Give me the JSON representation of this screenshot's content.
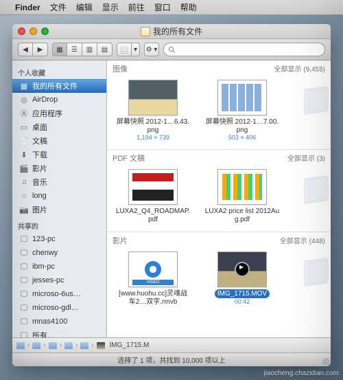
{
  "menubar": {
    "apple": "",
    "app": "Finder",
    "items": [
      "文件",
      "编辑",
      "显示",
      "前往",
      "窗口",
      "帮助"
    ]
  },
  "window": {
    "title": "我的所有文件",
    "search_placeholder": ""
  },
  "sidebar": {
    "section1": "个人收藏",
    "items1": [
      {
        "label": "我的所有文件",
        "icon": "all-files-icon",
        "selected": true
      },
      {
        "label": "AirDrop",
        "icon": "airdrop-icon"
      },
      {
        "label": "应用程序",
        "icon": "applications-icon"
      },
      {
        "label": "桌面",
        "icon": "desktop-icon"
      },
      {
        "label": "文稿",
        "icon": "documents-icon"
      },
      {
        "label": "下载",
        "icon": "downloads-icon"
      },
      {
        "label": "影片",
        "icon": "movies-icon"
      },
      {
        "label": "音乐",
        "icon": "music-icon"
      },
      {
        "label": "long",
        "icon": "home-icon"
      },
      {
        "label": "图片",
        "icon": "pictures-icon"
      }
    ],
    "section2": "共享的",
    "items2": [
      {
        "label": "123-pc"
      },
      {
        "label": "chenwy"
      },
      {
        "label": "ibm-pc"
      },
      {
        "label": "jesses-pc"
      },
      {
        "label": "microso-6us…"
      },
      {
        "label": "microso-gdl…"
      },
      {
        "label": "mnas4100"
      },
      {
        "label": "所有…"
      }
    ]
  },
  "content": {
    "sections": [
      {
        "name": "图像",
        "show_all": "全部显示",
        "count": "(9,455)",
        "items": [
          {
            "name": "屏幕快照 2012-1…6.43.png",
            "meta": "1,194 × 739",
            "thumb": "photo"
          },
          {
            "name": "屏幕快照 2012-1…7.00.png",
            "meta": "503 × 406",
            "thumb": "screen"
          }
        ]
      },
      {
        "name": "PDF 文稿",
        "show_all": "全部显示",
        "count": "(3)",
        "items": [
          {
            "name": "LUXA2_Q4_ROADMAP.pdf",
            "meta": "",
            "thumb": "pdf1"
          },
          {
            "name": "LUXA2 price list 2012Aug.pdf",
            "meta": "",
            "thumb": "pdf2"
          }
        ]
      },
      {
        "name": "影片",
        "show_all": "全部显示",
        "count": "(448)",
        "items": [
          {
            "name": "[www.huohu.cc]灵魂战车2…双字.rmvb",
            "meta": "",
            "thumb": "video1"
          },
          {
            "name": "IMG_1715.MOV",
            "meta": "00:42",
            "thumb": "video2",
            "selected": true
          }
        ]
      }
    ]
  },
  "pathbar": {
    "items": [
      "",
      "",
      "",
      "",
      "",
      "IMG_1715.M"
    ]
  },
  "statusbar": "选择了 1 项，共找到 10,000 项以上",
  "watermark": "jiaocheng.chazidian.com"
}
